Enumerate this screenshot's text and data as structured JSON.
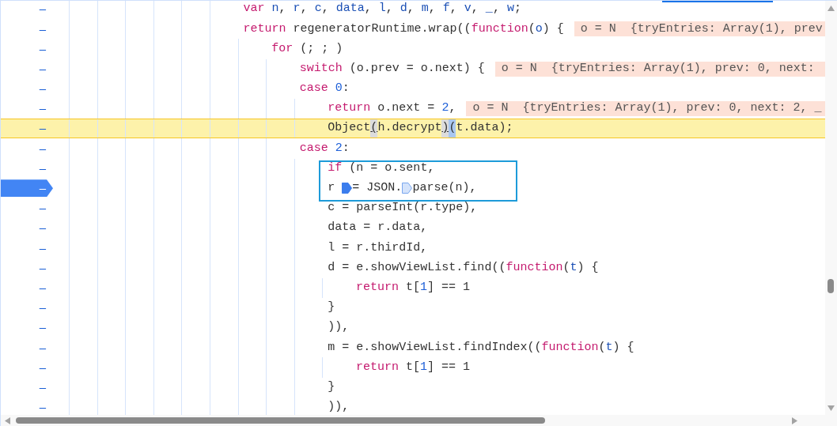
{
  "lines": [
    {
      "gutter": "–",
      "tokens": [
        {
          "kind": "keyword",
          "text": "var "
        },
        {
          "kind": "def",
          "text": "n"
        },
        {
          "kind": "plain",
          "text": ", "
        },
        {
          "kind": "def",
          "text": "r"
        },
        {
          "kind": "plain",
          "text": ", "
        },
        {
          "kind": "def",
          "text": "c"
        },
        {
          "kind": "plain",
          "text": ", "
        },
        {
          "kind": "def",
          "text": "data"
        },
        {
          "kind": "plain",
          "text": ", "
        },
        {
          "kind": "def",
          "text": "l"
        },
        {
          "kind": "plain",
          "text": ", "
        },
        {
          "kind": "def",
          "text": "d"
        },
        {
          "kind": "plain",
          "text": ", "
        },
        {
          "kind": "def",
          "text": "m"
        },
        {
          "kind": "plain",
          "text": ", "
        },
        {
          "kind": "def",
          "text": "f"
        },
        {
          "kind": "plain",
          "text": ", "
        },
        {
          "kind": "def",
          "text": "v"
        },
        {
          "kind": "plain",
          "text": ", "
        },
        {
          "kind": "def",
          "text": "_"
        },
        {
          "kind": "plain",
          "text": ", "
        },
        {
          "kind": "def",
          "text": "w"
        },
        {
          "kind": "plain",
          "text": ";"
        }
      ]
    },
    {
      "gutter": "–",
      "tokens": [
        {
          "kind": "keyword",
          "text": "return"
        },
        {
          "kind": "plain",
          "text": " regeneratorRuntime.wrap(("
        },
        {
          "kind": "keyword",
          "text": "function"
        },
        {
          "kind": "plain",
          "text": "("
        },
        {
          "kind": "def",
          "text": "o"
        },
        {
          "kind": "plain",
          "text": ") {"
        }
      ],
      "inline_value": "o = N  {tryEntries: Array(1), prev",
      "children": [
        {
          "gutter": "–",
          "tokens": [
            {
              "kind": "keyword",
              "text": "for"
            },
            {
              "kind": "plain",
              "text": " (; ; )"
            }
          ],
          "children": [
            {
              "gutter": "–",
              "tokens": [
                {
                  "kind": "keyword",
                  "text": "switch"
                },
                {
                  "kind": "plain",
                  "text": " (o.prev = o.next) {"
                }
              ],
              "inline_value": "o = N  {tryEntries: Array(1), prev: 0, next:"
            },
            {
              "gutter": "–",
              "tokens": [
                {
                  "kind": "keyword",
                  "text": "case "
                },
                {
                  "kind": "number",
                  "text": "0"
                },
                {
                  "kind": "plain",
                  "text": ":"
                }
              ],
              "children": [
                {
                  "gutter": "–",
                  "tokens": [
                    {
                      "kind": "keyword",
                      "text": "return"
                    },
                    {
                      "kind": "plain",
                      "text": " o.next = "
                    },
                    {
                      "kind": "number",
                      "text": "2"
                    },
                    {
                      "kind": "plain",
                      "text": ","
                    }
                  ],
                  "inline_value": "o = N  {tryEntries: Array(1), prev: 0, next: 2, _"
                },
                {
                  "gutter": "–",
                  "paused": true,
                  "tokens": [
                    {
                      "kind": "plain",
                      "text": "Object"
                    },
                    {
                      "kind": "match",
                      "text": "("
                    },
                    {
                      "kind": "plain",
                      "text": "h.decrypt"
                    },
                    {
                      "kind": "match",
                      "text": ")"
                    },
                    {
                      "kind": "selected",
                      "text": "("
                    },
                    {
                      "kind": "plain",
                      "text": "t.data);"
                    }
                  ]
                }
              ]
            },
            {
              "gutter": "–",
              "tokens": [
                {
                  "kind": "keyword",
                  "text": "case "
                },
                {
                  "kind": "number",
                  "text": "2"
                },
                {
                  "kind": "plain",
                  "text": ":"
                }
              ],
              "children": [
                {
                  "gutter": "–",
                  "framed": true,
                  "tokens": [
                    {
                      "kind": "keyword",
                      "text": "if"
                    },
                    {
                      "kind": "plain",
                      "text": " (n = o.sent,"
                    }
                  ]
                },
                {
                  "gutter": "–",
                  "framed": true,
                  "breakpoint": true,
                  "tokens": [
                    {
                      "kind": "plain",
                      "text": "r "
                    },
                    {
                      "kind": "marker",
                      "active": true
                    },
                    {
                      "kind": "plain",
                      "text": "= JSON."
                    },
                    {
                      "kind": "marker",
                      "active": false
                    },
                    {
                      "kind": "plain",
                      "text": "parse(n),"
                    }
                  ]
                },
                {
                  "gutter": "–",
                  "tokens": [
                    {
                      "kind": "plain",
                      "text": "c = parseInt(r.type),"
                    }
                  ]
                },
                {
                  "gutter": "–",
                  "tokens": [
                    {
                      "kind": "plain",
                      "text": "data = r.data,"
                    }
                  ]
                },
                {
                  "gutter": "–",
                  "tokens": [
                    {
                      "kind": "plain",
                      "text": "l = r.thirdId,"
                    }
                  ]
                },
                {
                  "gutter": "–",
                  "tokens": [
                    {
                      "kind": "plain",
                      "text": "d = e.showViewList.find(("
                    },
                    {
                      "kind": "keyword",
                      "text": "function"
                    },
                    {
                      "kind": "plain",
                      "text": "("
                    },
                    {
                      "kind": "def",
                      "text": "t"
                    },
                    {
                      "kind": "plain",
                      "text": ") {"
                    }
                  ],
                  "children": [
                    {
                      "gutter": "–",
                      "tokens": [
                        {
                          "kind": "keyword",
                          "text": "return"
                        },
                        {
                          "kind": "plain",
                          "text": " t["
                        },
                        {
                          "kind": "number",
                          "text": "1"
                        },
                        {
                          "kind": "plain",
                          "text": "] == 1"
                        }
                      ]
                    }
                  ]
                },
                {
                  "gutter": "–",
                  "tokens": [
                    {
                      "kind": "plain",
                      "text": "}"
                    }
                  ]
                },
                {
                  "gutter": "–",
                  "tokens": [
                    {
                      "kind": "plain",
                      "text": ")),"
                    }
                  ]
                },
                {
                  "gutter": "–",
                  "tokens": [
                    {
                      "kind": "plain",
                      "text": "m = e.showViewList.findIndex(("
                    },
                    {
                      "kind": "keyword",
                      "text": "function"
                    },
                    {
                      "kind": "plain",
                      "text": "("
                    },
                    {
                      "kind": "def",
                      "text": "t"
                    },
                    {
                      "kind": "plain",
                      "text": ") {"
                    }
                  ],
                  "children": [
                    {
                      "gutter": "–",
                      "tokens": [
                        {
                          "kind": "keyword",
                          "text": "return"
                        },
                        {
                          "kind": "plain",
                          "text": " t["
                        },
                        {
                          "kind": "number",
                          "text": "1"
                        },
                        {
                          "kind": "plain",
                          "text": "] == 1"
                        }
                      ]
                    }
                  ]
                },
                {
                  "gutter": "–",
                  "tokens": [
                    {
                      "kind": "plain",
                      "text": "}"
                    }
                  ]
                },
                {
                  "gutter": "–",
                  "tokens": [
                    {
                      "kind": "plain",
                      "text": ")),"
                    }
                  ]
                }
              ]
            }
          ]
        }
      ]
    }
  ]
}
